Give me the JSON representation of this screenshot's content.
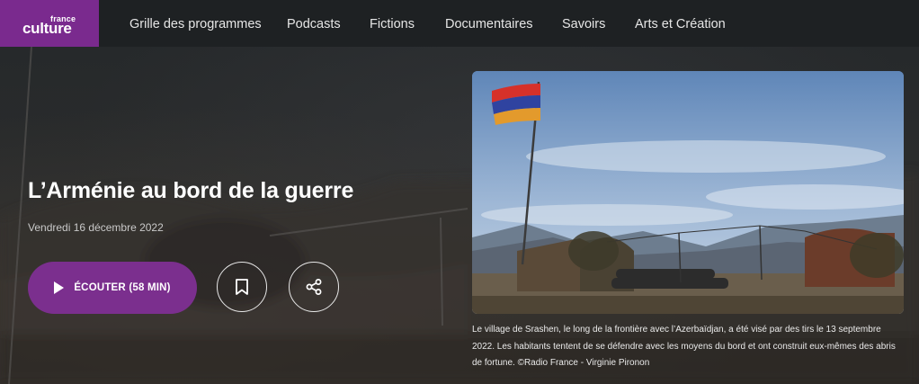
{
  "logo": {
    "small": "france",
    "big": "culture"
  },
  "nav": {
    "items": [
      {
        "label": "Grille des programmes"
      },
      {
        "label": "Podcasts"
      },
      {
        "label": "Fictions"
      },
      {
        "label": "Documentaires"
      },
      {
        "label": "Savoirs"
      },
      {
        "label": "Arts et Création"
      }
    ]
  },
  "hero": {
    "title": "L’Arménie au bord de la guerre",
    "date": "Vendredi 16 décembre 2022",
    "listen_label": "ÉCOUTER (58 MIN)"
  },
  "photo": {
    "caption": "Le village de Srashen, le long de la frontière avec l’Azerbaïdjan, a été visé par des tirs le 13 septembre 2022. Les habitants tentent de se défendre avec les moyens du bord et ont construit eux-mêmes des abris de fortune. ©Radio France - Virginie Pironon"
  },
  "colors": {
    "brand": "#7a2a8e",
    "background": "#1f2224"
  },
  "icons": [
    "play-icon",
    "bookmark-icon",
    "share-icon"
  ]
}
